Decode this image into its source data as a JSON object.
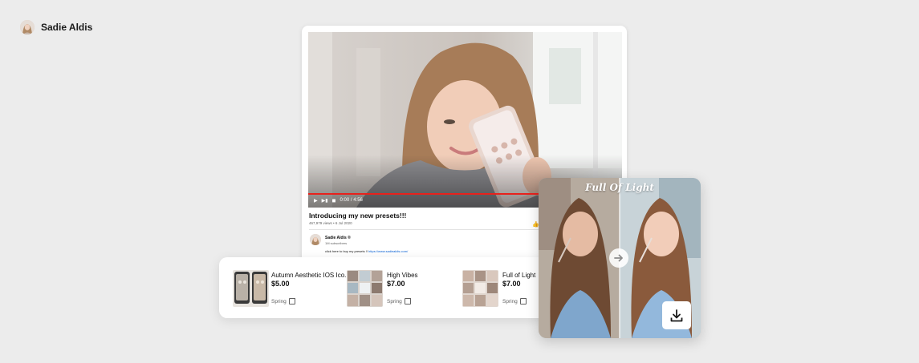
{
  "creator": {
    "name": "Sadie Aldis"
  },
  "video": {
    "time": "0:00 / 4:56",
    "progress": 0.995,
    "title": "Introducing my new presets!!!",
    "meta": "467,979 views • 6 Jul 2020",
    "channel_name": "Sadie Aldis ®",
    "channel_subs": "1M subscribers",
    "description": "click here to buy my presets !!",
    "description_link": "https://www.sadiealdis.com/"
  },
  "products": [
    {
      "title": "Autumn Aesthetic IOS Ico...",
      "price": "$5.00",
      "source": "Spring"
    },
    {
      "title": "High Vibes",
      "price": "$7.00",
      "source": "Spring"
    },
    {
      "title": "Full of Light",
      "price": "$7.00",
      "source": "Spring"
    }
  ],
  "preset": {
    "title": "Full Of Light"
  },
  "icons": {
    "play": "play-icon",
    "next": "next-icon",
    "volume": "volume-icon",
    "like": "like-icon",
    "external": "external-link-icon",
    "arrow": "arrow-right-icon",
    "download": "download-icon"
  },
  "colors": {
    "accent_red": "#e8211c",
    "link_blue": "#065fd4",
    "background": "#ececec"
  }
}
